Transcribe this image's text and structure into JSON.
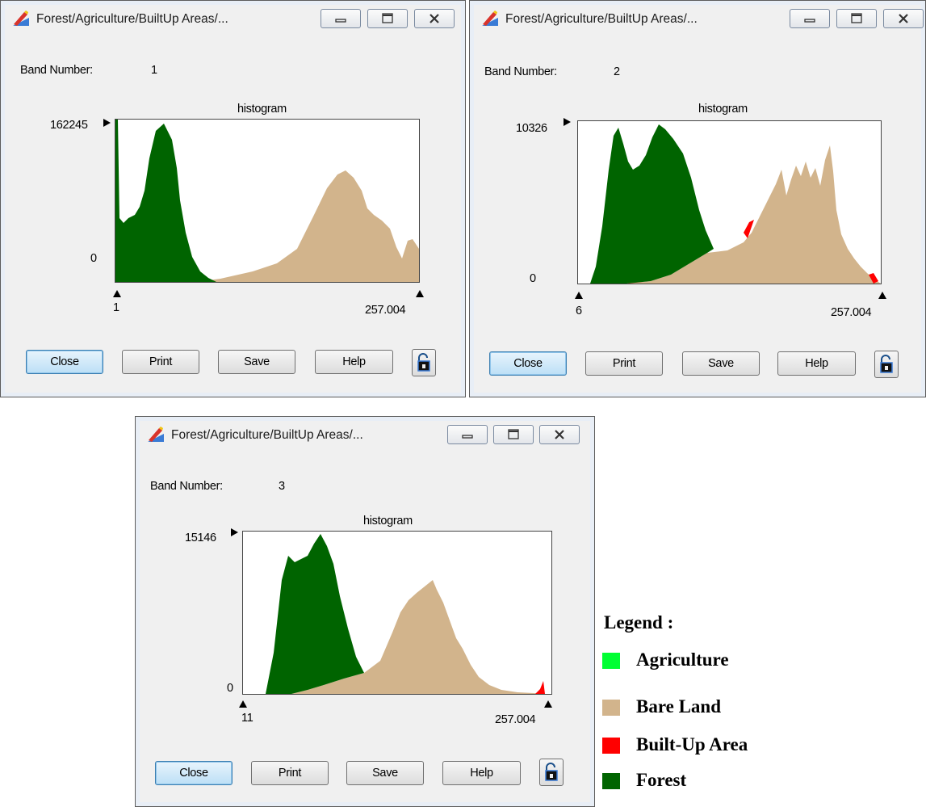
{
  "windows": [
    {
      "title": "Forest/Agriculture/BuiltUp Areas/...",
      "band_label": "Band Number:",
      "band_value": "1",
      "plot_title": "histogram",
      "y_max": "162245",
      "y_min": "0",
      "x_min": "1",
      "x_max": "257.004",
      "buttons": {
        "close": "Close",
        "print": "Print",
        "save": "Save",
        "help": "Help"
      }
    },
    {
      "title": "Forest/Agriculture/BuiltUp Areas/...",
      "band_label": "Band Number:",
      "band_value": "2",
      "plot_title": "histogram",
      "y_max": "10326",
      "y_min": "0",
      "x_min": "6",
      "x_max": "257.004",
      "buttons": {
        "close": "Close",
        "print": "Print",
        "save": "Save",
        "help": "Help"
      }
    },
    {
      "title": "Forest/Agriculture/BuiltUp Areas/...",
      "band_label": "Band Number:",
      "band_value": "3",
      "plot_title": "histogram",
      "y_max": "15146",
      "y_min": "0",
      "x_min": "11",
      "x_max": "257.004",
      "buttons": {
        "close": "Close",
        "print": "Print",
        "save": "Save",
        "help": "Help"
      }
    }
  ],
  "legend": {
    "title": "Legend :",
    "items": [
      {
        "label": "Agriculture",
        "color": "#00ff33"
      },
      {
        "label": "Bare Land",
        "color": "#d2b48c"
      },
      {
        "label": "Built-Up Area",
        "color": "#ff0000"
      },
      {
        "label": "Forest",
        "color": "#006400"
      }
    ]
  },
  "colors": {
    "forest": "#006400",
    "bare_land": "#d2b48c",
    "built_up": "#ff0000",
    "agriculture": "#00ff33",
    "default_button": "#bcdff6"
  },
  "icons": {
    "app": "pencil-ruler-icon",
    "minimize": "minimize-icon",
    "maximize": "maximize-icon",
    "close": "close-x-icon",
    "lock": "unlocked-padlock-icon"
  }
}
